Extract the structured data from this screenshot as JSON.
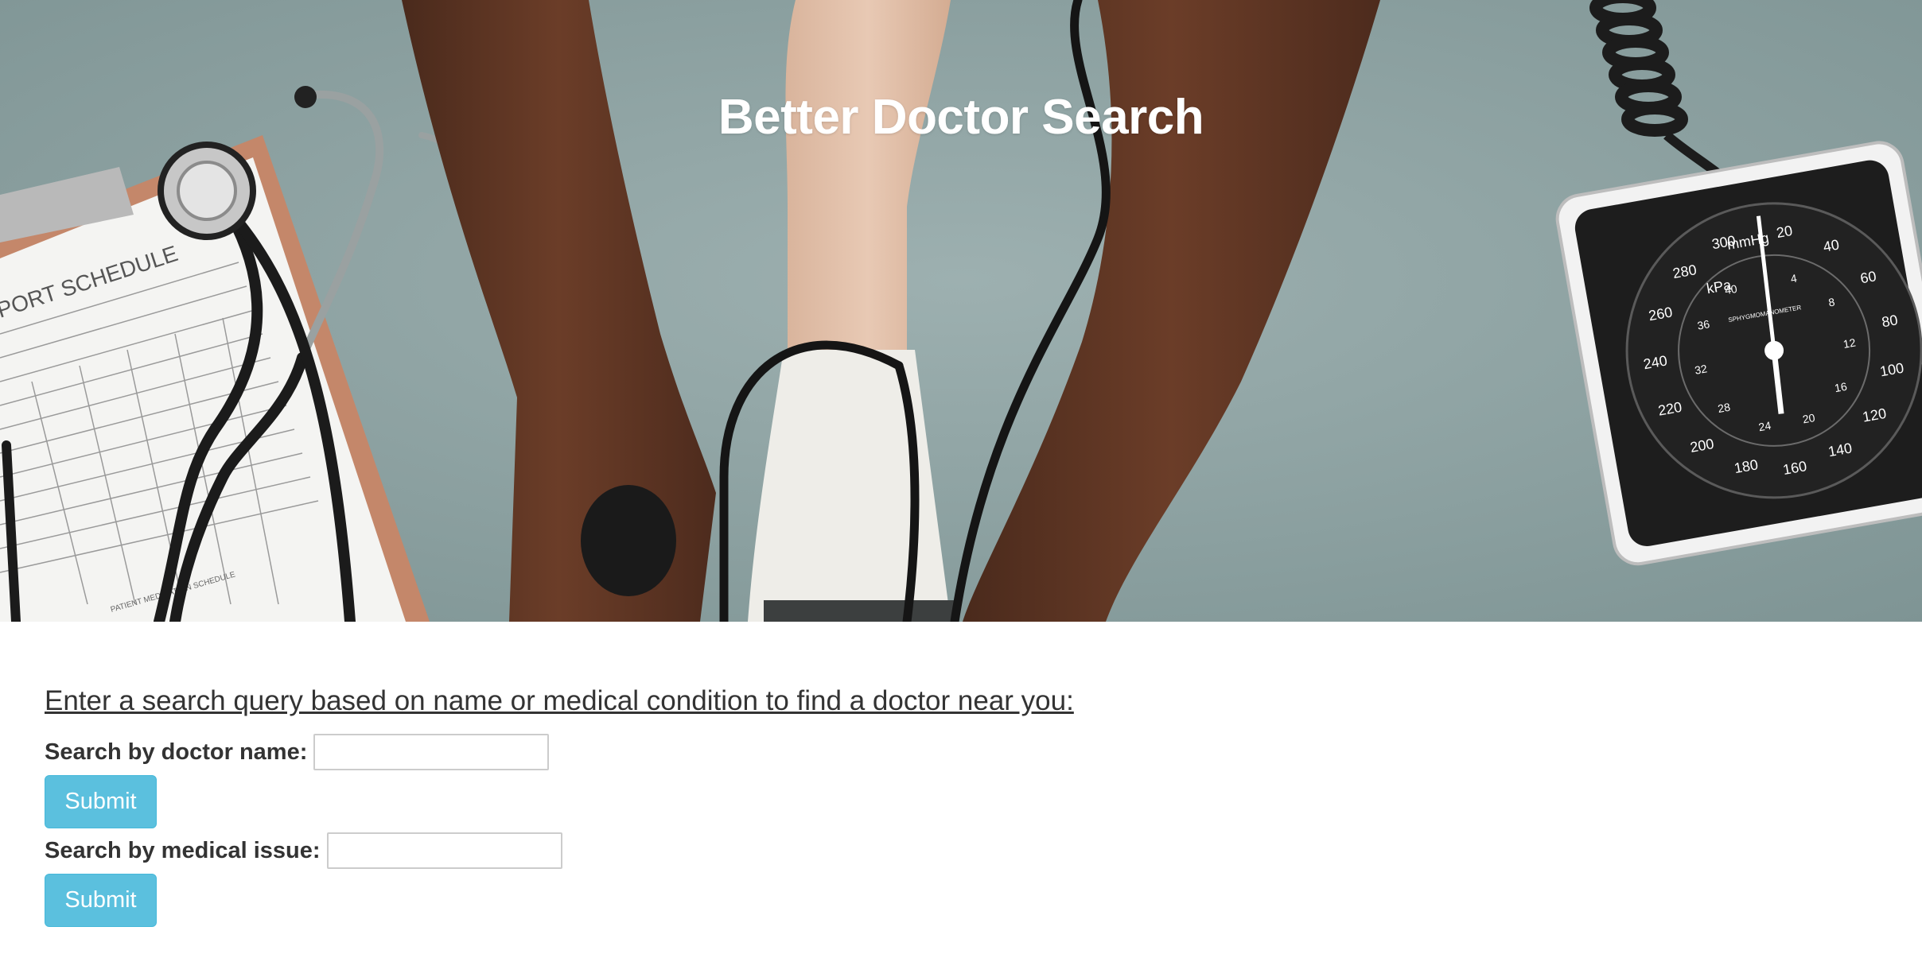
{
  "hero": {
    "title": "Better Doctor Search",
    "clipboard_heading": "PORT SCHEDULE",
    "clipboard_subheading": "PATIENT MEDICATION SCHEDULE",
    "gauge_unit_1": "mmHg",
    "gauge_unit_2": "kPa",
    "gauge_brand": "SPHYGMOMANOMETER",
    "gauge_outer_ticks": [
      "20",
      "40",
      "60",
      "80",
      "100",
      "120",
      "140",
      "160",
      "180",
      "200",
      "220",
      "240",
      "260",
      "280",
      "300"
    ],
    "gauge_inner_ticks": [
      "4",
      "8",
      "12",
      "16",
      "20",
      "24",
      "28",
      "32",
      "36",
      "40"
    ]
  },
  "search": {
    "prompt": "Enter a search query based on name or medical condition to find a doctor near you:",
    "name_label": "Search by doctor name:",
    "name_value": "",
    "name_submit": "Submit",
    "issue_label": "Search by medical issue:",
    "issue_value": "",
    "issue_submit": "Submit"
  },
  "colors": {
    "button_bg": "#5bc0de",
    "button_border": "#46b8da",
    "hero_bg": "#8fa3a3",
    "text": "#333333"
  }
}
